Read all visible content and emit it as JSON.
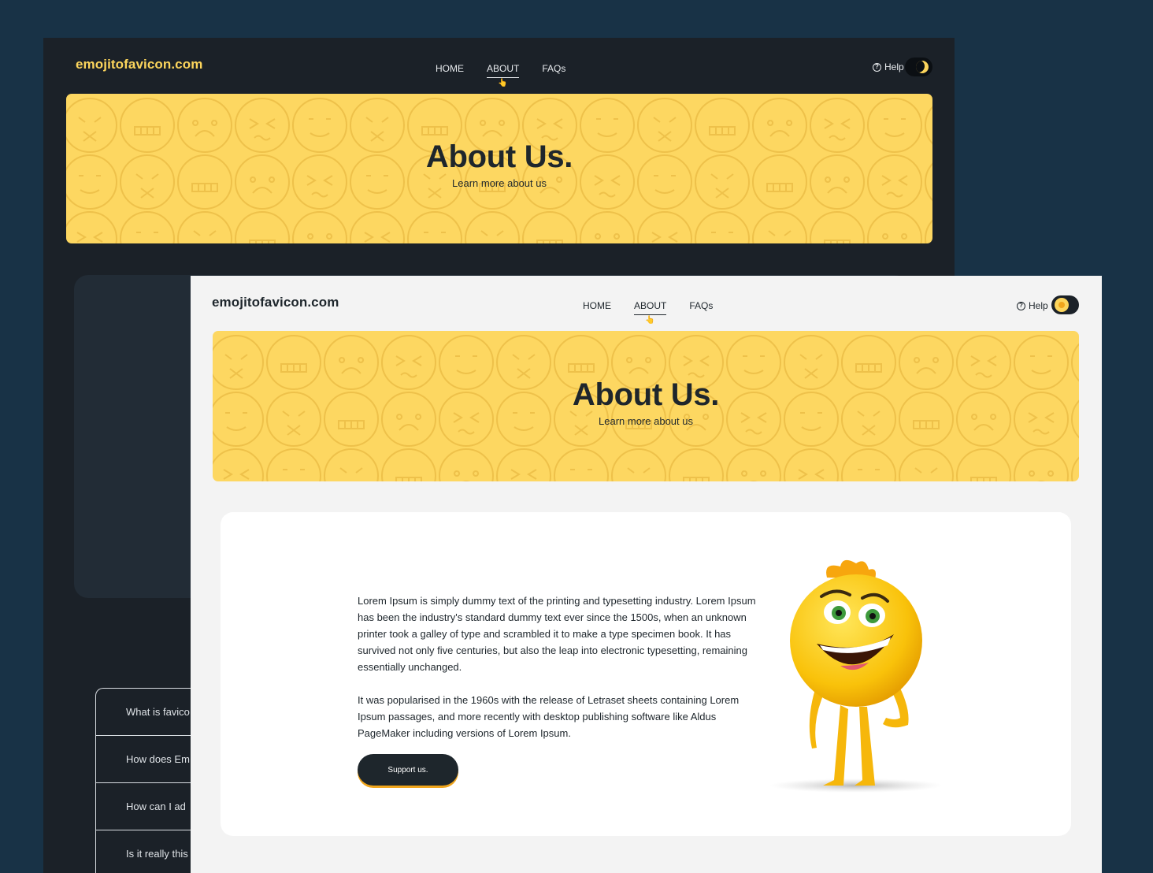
{
  "dark_window": {
    "logo": "emojitofavicon.com",
    "nav": {
      "home": "HOME",
      "about": "ABOUT",
      "faqs": "FAQs"
    },
    "help": "Help",
    "hero": {
      "title": "About Us.",
      "subtitle": "Learn more about us"
    },
    "faq_items": [
      "What is favico",
      "How does Em",
      "How can I ad",
      "Is it really this"
    ]
  },
  "light_window": {
    "logo": "emojitofavicon.com",
    "nav": {
      "home": "HOME",
      "about": "ABOUT",
      "faqs": "FAQs"
    },
    "help": "Help",
    "hero": {
      "title": "About Us.",
      "subtitle": "Learn more about us"
    },
    "content": {
      "paragraph_1": "Lorem Ipsum is simply dummy text of the printing and typesetting industry. Lorem Ipsum has been the industry's standard dummy text ever since the 1500s, when an unknown printer took a galley of type and scrambled it to make a type specimen book. It has survived not only five centuries, but also the leap into electronic typesetting, remaining essentially unchanged.",
      "paragraph_2": "It was popularised in the 1960s with the release of Letraset sheets containing Lorem Ipsum passages, and more recently with desktop publishing software like Aldus PageMaker including versions of Lorem Ipsum.",
      "button": "Support us."
    }
  },
  "icons": {
    "help": "question-circle-icon",
    "dark_toggle": "moon-icon",
    "light_toggle": "sun-icon",
    "nav_pointer": "hand-pointer-icon",
    "mascot": "smiley-mascot"
  },
  "colors": {
    "page_background": "#183246",
    "dark_window": "#1b2128",
    "light_window": "#f3f3f3",
    "brand_yellow": "#fdd761",
    "accent_orange": "#f0a51c",
    "text_dark": "#1e262c"
  }
}
